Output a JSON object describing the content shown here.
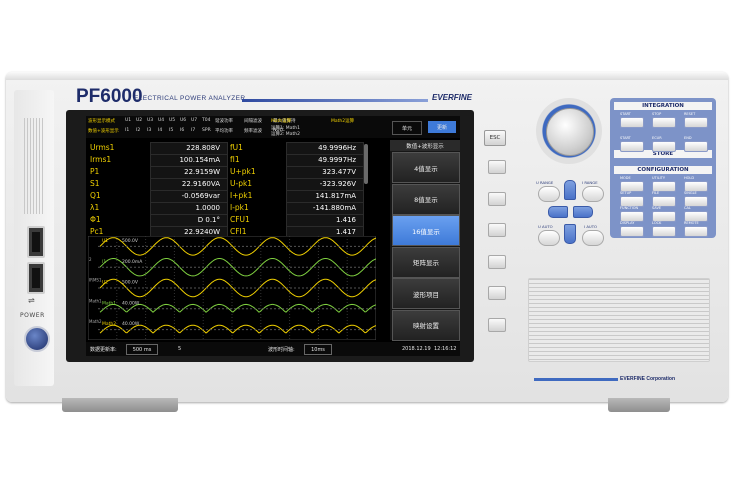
{
  "header": {
    "model": "PF6000",
    "subtitle": "ELECTRICAL POWER ANALYZER",
    "brand": "EVERFINE"
  },
  "footer_brand": "EVERFINE Corporation",
  "left_panel": {
    "power_label": "POWER"
  },
  "topbar": {
    "row1": [
      "波形显示模式",
      "U1",
      "U2",
      "U3",
      "U4",
      "U5",
      "U6",
      "U7",
      "T04",
      "谐波功率",
      "间隔滤波",
      "最大值保持"
    ],
    "row2": [
      "数值+波形显示",
      "I1",
      "I2",
      "I3",
      "I4",
      "I5",
      "I6",
      "I7",
      "SPR",
      "平均功率",
      "频率滤波",
      "NULL"
    ],
    "math1": "运算1: Math1",
    "math2": "运算2: Math2",
    "tag_math": "Math运算",
    "tag_math2": "Math2运算",
    "btn_single": "单元",
    "btn_update": "更新"
  },
  "measurements": {
    "left": [
      {
        "label": "Urms1",
        "value": "228.808V"
      },
      {
        "label": "Irms1",
        "value": "100.154mA"
      },
      {
        "label": "P1",
        "value": "22.9159W"
      },
      {
        "label": "S1",
        "value": "22.9160VA"
      },
      {
        "label": "Q1",
        "value": "-0.0569var"
      },
      {
        "label": "λ1",
        "value": "1.0000"
      },
      {
        "label": "Φ1",
        "value": "D 0.1°"
      },
      {
        "label": "Pc1",
        "value": "22.9240W"
      }
    ],
    "right": [
      {
        "label": "fU1",
        "value": "49.9996Hz"
      },
      {
        "label": "fI1",
        "value": "49.9997Hz"
      },
      {
        "label": "U+pk1",
        "value": "323.477V"
      },
      {
        "label": "U-pk1",
        "value": "-323.926V"
      },
      {
        "label": "I+pk1",
        "value": "141.817mA"
      },
      {
        "label": "I-pk1",
        "value": "-141.880mA"
      },
      {
        "label": "CFU1",
        "value": "1.416"
      },
      {
        "label": "CFI1",
        "value": "1.417"
      }
    ]
  },
  "menu": {
    "header": "数值+波形显示",
    "items": [
      "4值显示",
      "8值显示",
      "16值显示",
      "矩阵显示",
      "波形项目",
      "映射设置"
    ],
    "selected_index": 2
  },
  "waveform": {
    "traces": [
      {
        "tag": "U1",
        "scale": "500.0V",
        "color": "#f0d000",
        "cycles": 5.2
      },
      {
        "tag": "I1",
        "scale": "200.0mA",
        "color": "#7fd040",
        "cycles": 5.2
      },
      {
        "tag": "U2",
        "scale": "500.0V",
        "color": "#f0d000",
        "cycles": 5.2
      },
      {
        "tag": "Math1",
        "scale": "40.00W",
        "color": "#7fd040",
        "cycles": 10.4
      },
      {
        "tag": "Math2",
        "scale": "40.00W",
        "color": "#f0d000",
        "cycles": 10.4
      }
    ],
    "small_tags": [
      "2",
      "IRMS1",
      "Math1",
      "Math2"
    ]
  },
  "statusbar": {
    "update_label": "数据更新率:",
    "update_value": "500 ms",
    "count": "5",
    "window_label": "波形时间轴:",
    "window_value": "10ms",
    "date": "2018.12.19",
    "time": "12:16:12"
  },
  "right_controls": {
    "esc": "ESC",
    "range_left": "U RANGE",
    "range_right": "I RANGE",
    "auto_left": "U AUTO",
    "auto_right": "I AUTO",
    "integration": {
      "title": "INTEGRATION",
      "keys": [
        "START",
        "STOP",
        "RESET"
      ]
    },
    "store": {
      "title": "STORE",
      "keys": [
        "START",
        "ECUR",
        "END"
      ]
    },
    "configuration": {
      "title": "CONFIGURATION",
      "keys": [
        "MODE",
        "UTILITY",
        "HOLD",
        "SETUP",
        "FILE",
        "SINGLE",
        "FUNCTION",
        "SAVE",
        "CAL",
        "DISPLAY",
        "LOCK",
        "REMOTE"
      ]
    }
  },
  "colors": {
    "accent_blue": "#3f6ac0",
    "screen_bg": "#000000",
    "label_yellow": "#f0d000",
    "selected_blue": "#5a90e8"
  }
}
